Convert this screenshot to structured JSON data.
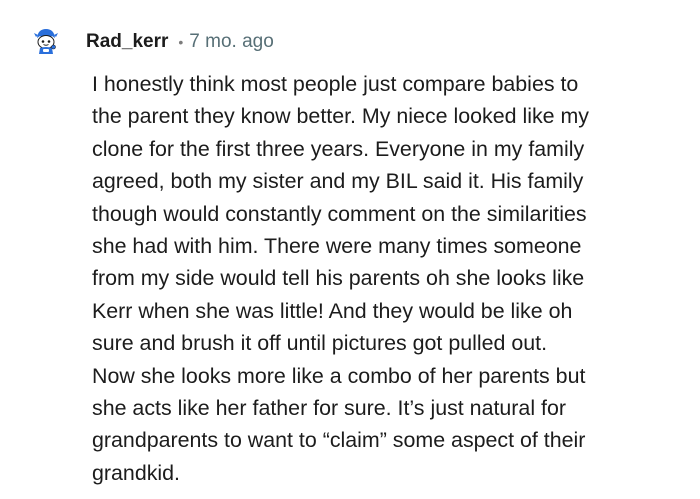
{
  "comment": {
    "author": "Rad_kerr",
    "separator": "•",
    "timestamp": "7 mo. ago",
    "avatar_icon": "snoo-avatar-icon",
    "body_lines": [
      "I honestly think most people just compare babies to",
      "the parent they know better. My niece looked like my",
      "clone for the first three years. Everyone in my family",
      "agreed, both my sister and my BIL said it. His family",
      "though would constantly comment on the similarities",
      "she had with him. There were many times someone",
      "from my side would tell his parents oh she looks like",
      "Kerr when she was little! And they would be like oh",
      "sure and brush it off until pictures got pulled out.",
      "Now she looks more like a combo of her parents but",
      "she acts like her father for sure. It’s just natural for",
      "grandparents to want to “claim” some aspect of their",
      "grandkid."
    ]
  },
  "colors": {
    "text": "#1c1c1c",
    "meta_text": "#576f76",
    "avatar_blue": "#2a6fdb"
  }
}
